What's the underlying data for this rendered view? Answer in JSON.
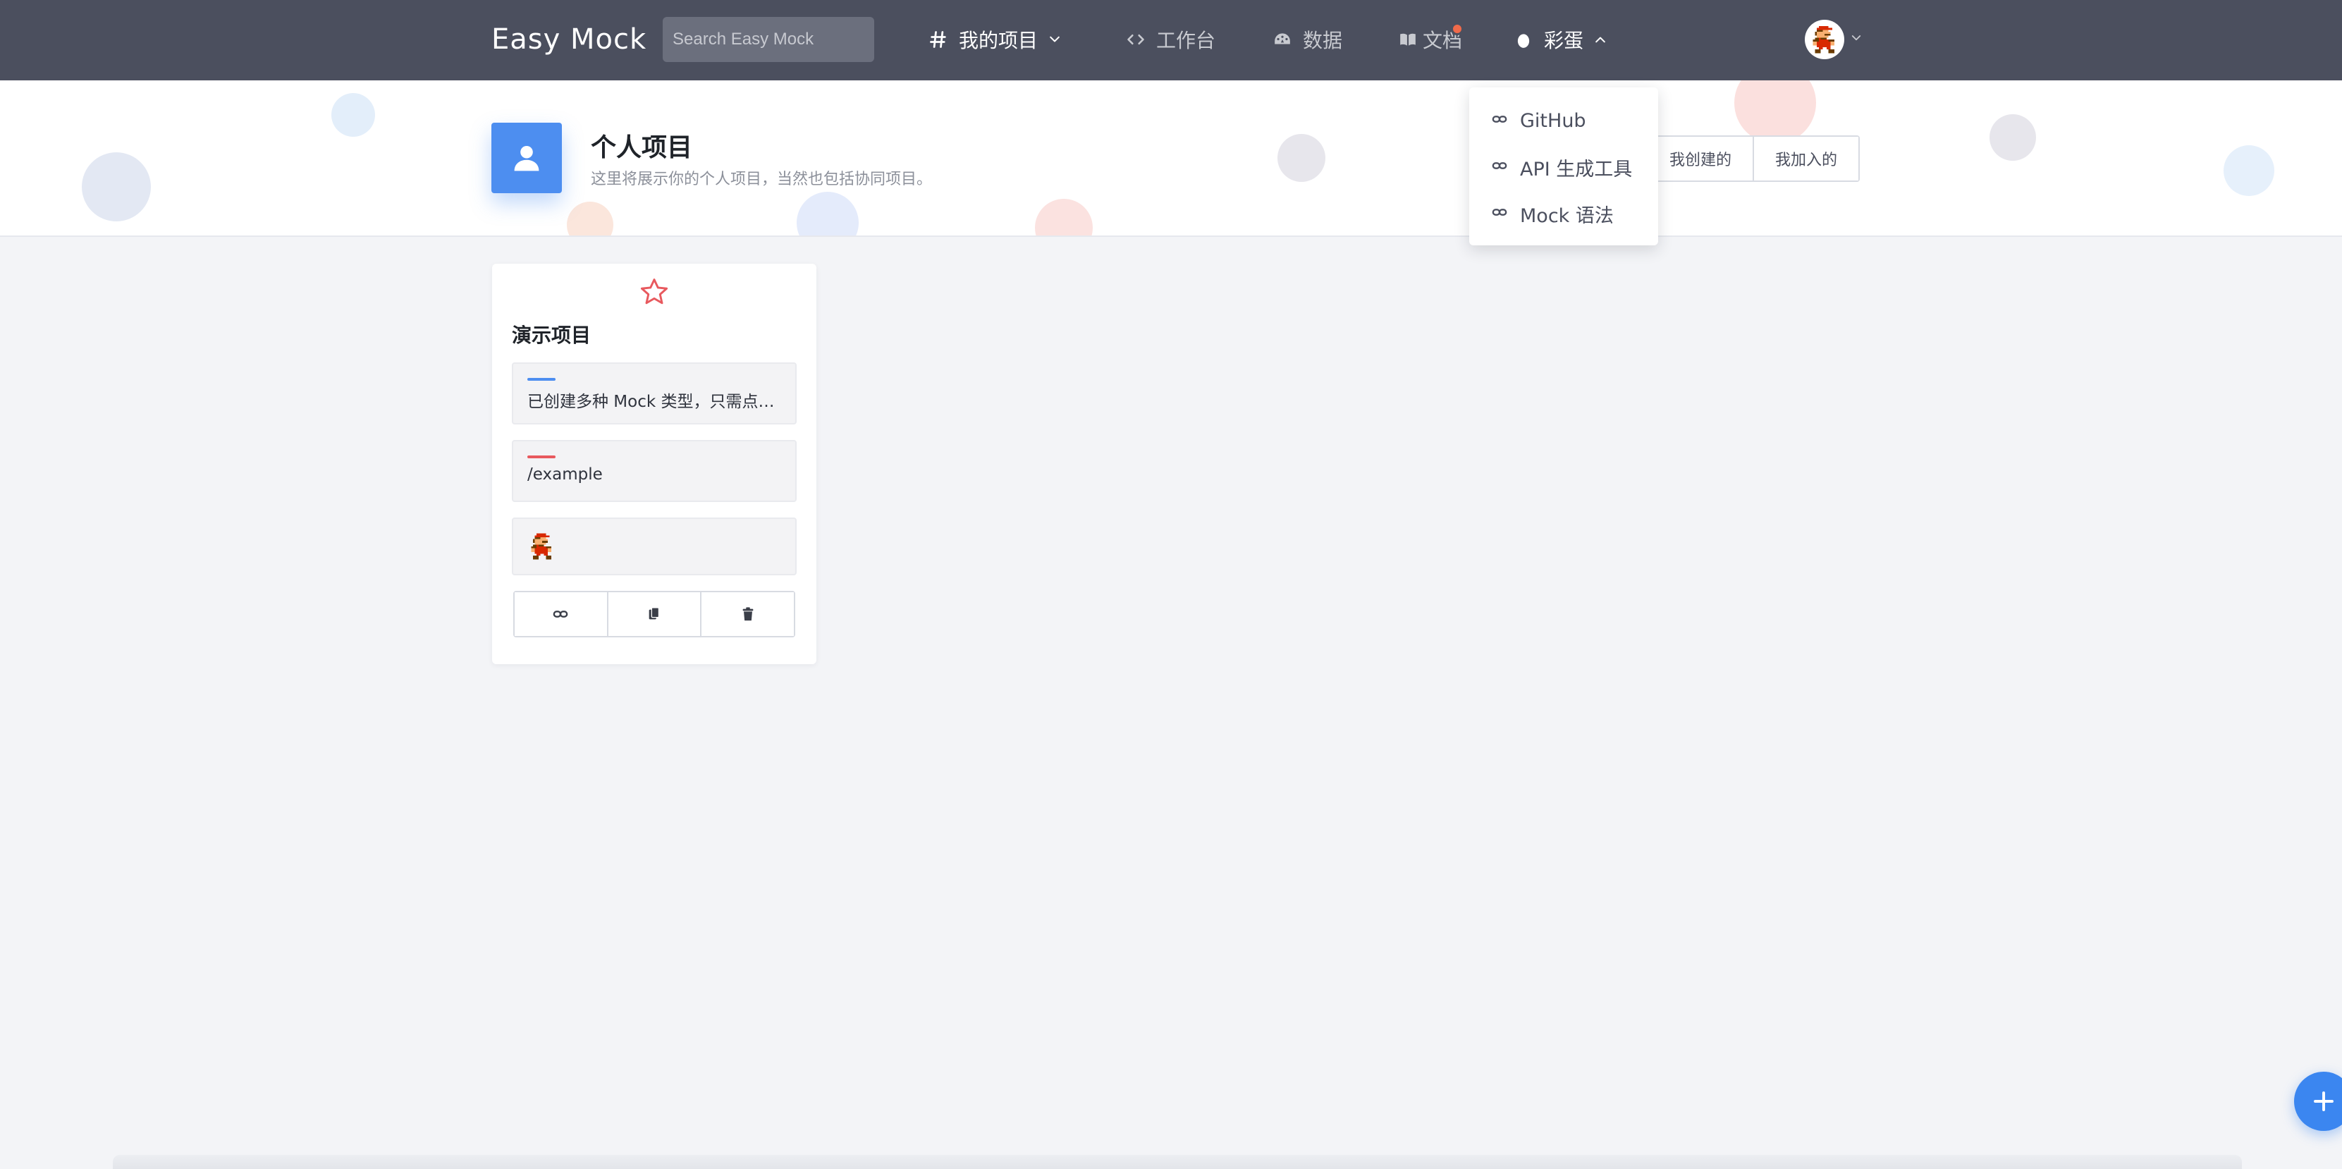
{
  "app": {
    "logo": "Easy Mock"
  },
  "search": {
    "placeholder": "Search Easy Mock"
  },
  "nav": {
    "projects": {
      "label": "我的项目",
      "icon": "hash-icon"
    },
    "workbench": {
      "label": "工作台",
      "icon": "code-icon"
    },
    "data": {
      "label": "数据",
      "icon": "dashboard-icon"
    },
    "docs": {
      "label": "文档",
      "icon": "book-icon",
      "has_notification": true
    },
    "egg": {
      "label": "彩蛋",
      "icon": "egg-icon"
    }
  },
  "dropdown": {
    "items": [
      {
        "label": "GitHub",
        "icon": "link-icon"
      },
      {
        "label": "API 生成工具",
        "icon": "link-icon"
      },
      {
        "label": "Mock 语法",
        "icon": "link-icon"
      }
    ]
  },
  "header": {
    "title": "个人项目",
    "subtitle": "这里将展示你的个人项目，当然也包括协同项目。",
    "filters": [
      {
        "label": "我创建的"
      },
      {
        "label": "我加入的"
      }
    ]
  },
  "projects": [
    {
      "name": "演示项目",
      "description": "已创建多种 Mock 类型，只需点击预览便可查看效果。",
      "url": "/example"
    }
  ],
  "colors": {
    "topbar": "#4b4f5e",
    "accent_blue": "#4d8ef0",
    "accent_red": "#e8595e",
    "fab": "#3b86f0"
  }
}
